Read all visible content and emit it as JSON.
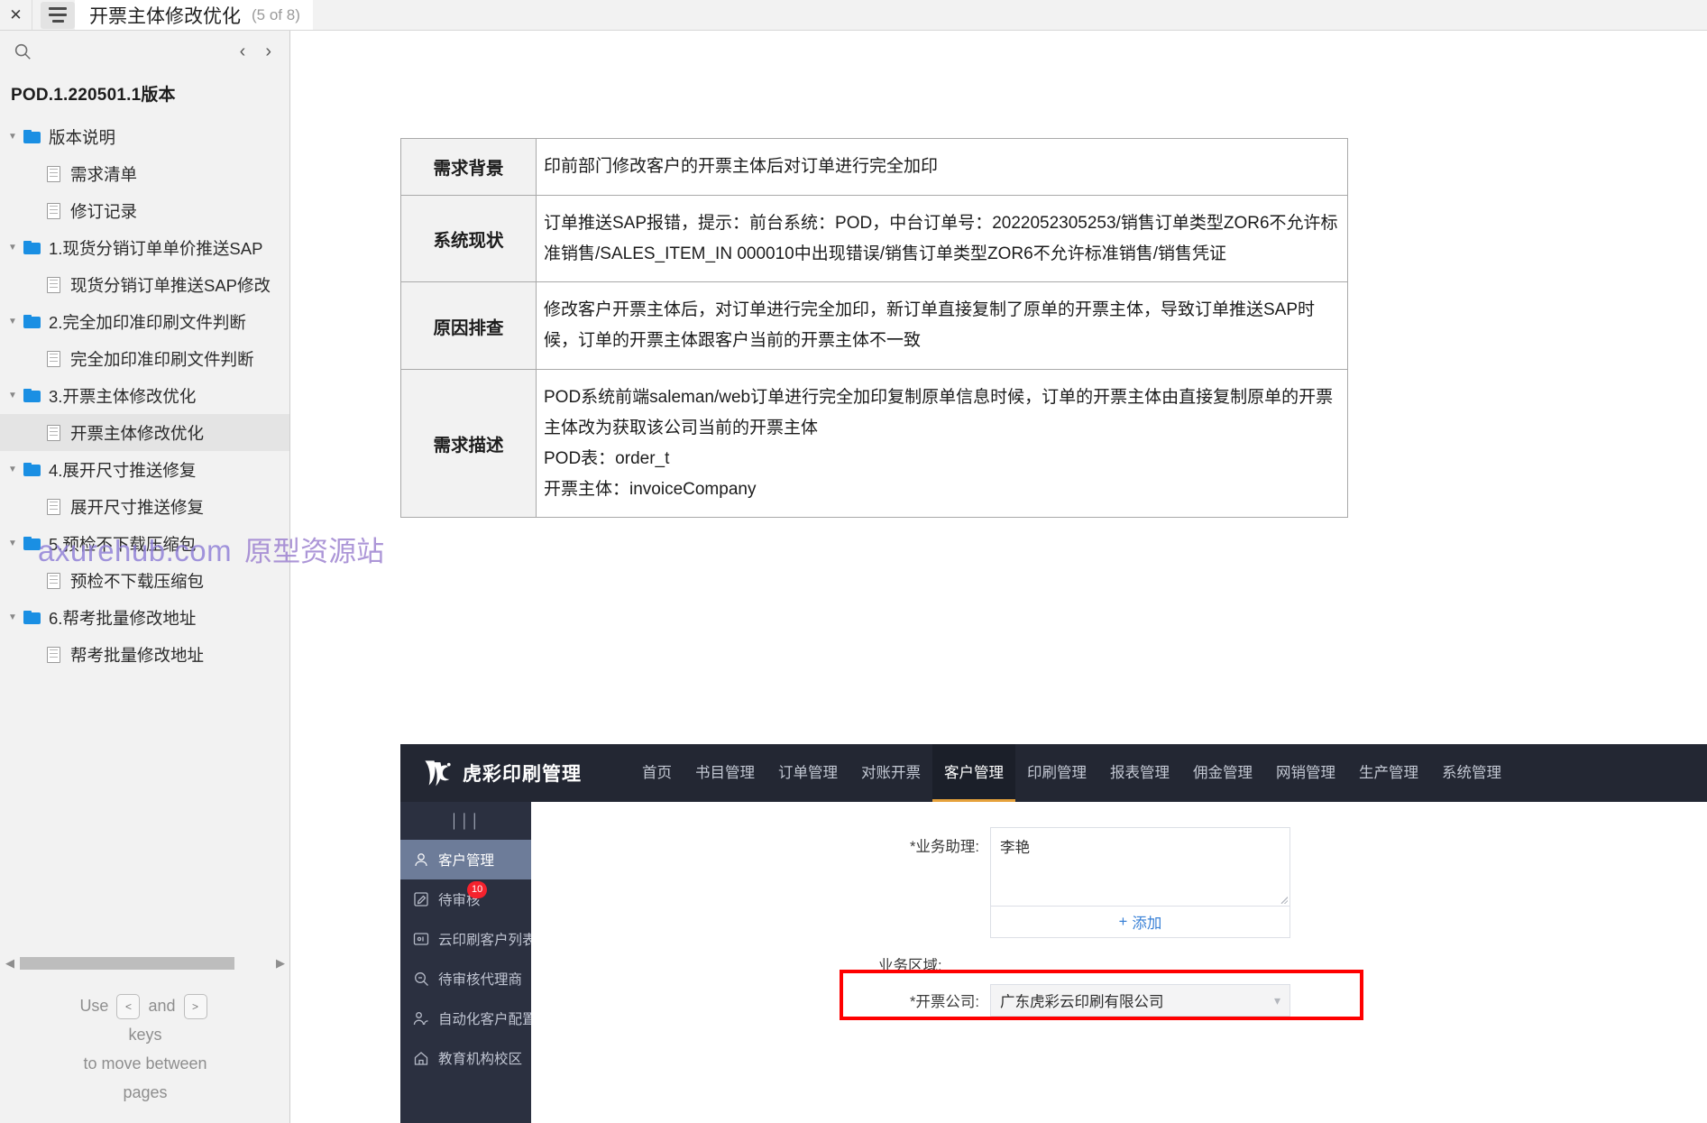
{
  "topbar": {
    "close_label": "✕",
    "menu_icon": "hamburger-icon",
    "title": "开票主体修改优化",
    "counter": "(5 of 8)"
  },
  "sidebar": {
    "search_icon": "search-icon",
    "prev_label": "‹",
    "next_label": "›",
    "version": "POD.1.220501.1版本",
    "tree": [
      {
        "level": 1,
        "type": "folder",
        "label": "版本说明",
        "expanded": true,
        "selected": false
      },
      {
        "level": 2,
        "type": "page",
        "label": "需求清单",
        "selected": false
      },
      {
        "level": 2,
        "type": "page",
        "label": "修订记录",
        "selected": false
      },
      {
        "level": 1,
        "type": "folder",
        "label": "1.现货分销订单单价推送SAP",
        "expanded": true,
        "selected": false
      },
      {
        "level": 2,
        "type": "page",
        "label": "现货分销订单推送SAP修改",
        "selected": false
      },
      {
        "level": 1,
        "type": "folder",
        "label": "2.完全加印准印刷文件判断",
        "expanded": true,
        "selected": false
      },
      {
        "level": 2,
        "type": "page",
        "label": "完全加印准印刷文件判断",
        "selected": false
      },
      {
        "level": 1,
        "type": "folder",
        "label": "3.开票主体修改优化",
        "expanded": true,
        "selected": false
      },
      {
        "level": 2,
        "type": "page",
        "label": "开票主体修改优化",
        "selected": true
      },
      {
        "level": 1,
        "type": "folder",
        "label": "4.展开尺寸推送修复",
        "expanded": true,
        "selected": false
      },
      {
        "level": 2,
        "type": "page",
        "label": "展开尺寸推送修复",
        "selected": false
      },
      {
        "level": 1,
        "type": "folder",
        "label": "5.预检不下载压缩包",
        "expanded": true,
        "selected": false
      },
      {
        "level": 2,
        "type": "page",
        "label": "预检不下载压缩包",
        "selected": false
      },
      {
        "level": 1,
        "type": "folder",
        "label": "6.帮考批量修改地址",
        "expanded": true,
        "selected": false
      },
      {
        "level": 2,
        "type": "page",
        "label": "帮考批量修改地址",
        "selected": false
      }
    ],
    "hint": {
      "use": "Use",
      "and": "and",
      "key_prev": "<",
      "key_next": ">",
      "line2": "keys",
      "line3": "to move between",
      "line4": "pages"
    }
  },
  "watermark": {
    "domain": "axurehub.com",
    "tagline": "原型资源站"
  },
  "doc_table": {
    "rows": [
      {
        "label": "需求背景",
        "lines": [
          "印前部门修改客户的开票主体后对订单进行完全加印"
        ]
      },
      {
        "label": "系统现状",
        "lines": [
          "订单推送SAP报错，提示：前台系统：POD，中台订单号：2022052305253/销售订单类型ZOR6不允许标准销售/SALES_ITEM_IN 000010中出现错误/销售订单类型ZOR6不允许标准销售/销售凭证"
        ]
      },
      {
        "label": "原因排查",
        "lines": [
          "修改客户开票主体后，对订单进行完全加印，新订单直接复制了原单的开票主体，导致订单推送SAP时候，订单的开票主体跟客户当前的开票主体不一致"
        ]
      },
      {
        "label": "需求描述",
        "lines": [
          "POD系统前端saleman/web订单进行完全加印复制原单信息时候，订单的开票主体由直接复制原单的开票主体改为获取该公司当前的开票主体",
          "POD表：order_t",
          "开票主体：invoiceCompany"
        ]
      }
    ]
  },
  "app": {
    "brand": "虎彩印刷管理",
    "nav": [
      {
        "label": "首页",
        "active": false
      },
      {
        "label": "书目管理",
        "active": false
      },
      {
        "label": "订单管理",
        "active": false
      },
      {
        "label": "对账开票",
        "active": false
      },
      {
        "label": "客户管理",
        "active": true
      },
      {
        "label": "印刷管理",
        "active": false
      },
      {
        "label": "报表管理",
        "active": false
      },
      {
        "label": "佣金管理",
        "active": false
      },
      {
        "label": "网销管理",
        "active": false
      },
      {
        "label": "生产管理",
        "active": false
      },
      {
        "label": "系统管理",
        "active": false
      }
    ],
    "side": {
      "collapse_icon": "collapse-icon",
      "items": [
        {
          "label": "客户管理",
          "icon": "user-icon",
          "active": true,
          "badge": ""
        },
        {
          "label": "待审核",
          "icon": "edit-icon",
          "active": false,
          "badge": "10"
        },
        {
          "label": "云印刷客户列表",
          "icon": "list-icon",
          "active": false,
          "badge": ""
        },
        {
          "label": "待审核代理商",
          "icon": "search-doc-icon",
          "active": false,
          "badge": ""
        },
        {
          "label": "自动化客户配置",
          "icon": "users-icon",
          "active": false,
          "badge": ""
        },
        {
          "label": "教育机构校区",
          "icon": "home-icon",
          "active": false,
          "badge": ""
        }
      ]
    },
    "form": {
      "assistant_label": "*业务助理:",
      "assistant_value": "李艳",
      "add_label": "添加",
      "add_icon": "plus-icon",
      "area_label": "业务区域:",
      "company_label": "*开票公司:",
      "company_value": "广东虎彩云印刷有限公司",
      "company_chevron": "chevron-down-icon"
    },
    "highlight_color": "#ff0000",
    "accent_color": "#e6a23c",
    "nav_bg": "#232733"
  }
}
